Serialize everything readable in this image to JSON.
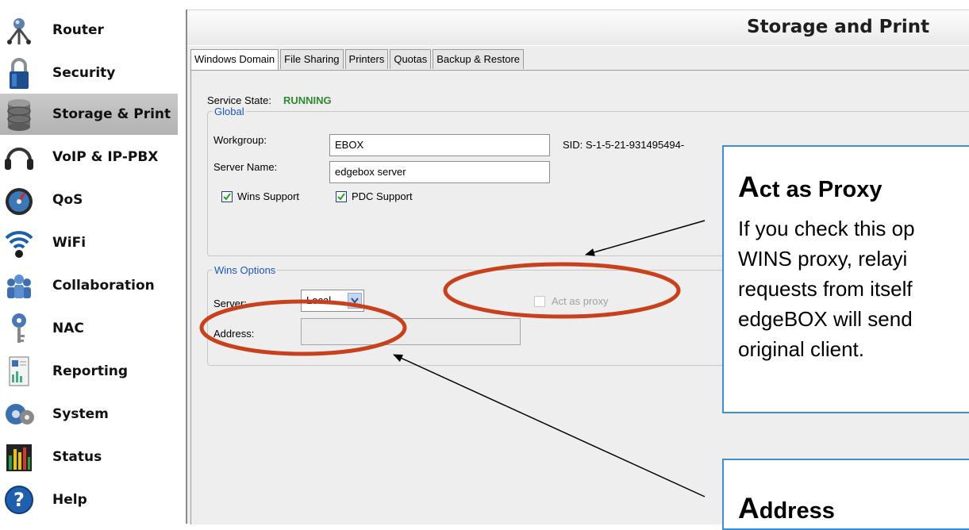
{
  "sidebar": {
    "items": [
      {
        "label": "Router",
        "icon": "router-icon"
      },
      {
        "label": "Security",
        "icon": "padlock-icon"
      },
      {
        "label": "Storage & Print",
        "icon": "database-icon",
        "active": true
      },
      {
        "label": "VoIP & IP-PBX",
        "icon": "headset-icon"
      },
      {
        "label": "QoS",
        "icon": "gauge-icon"
      },
      {
        "label": "WiFi",
        "icon": "wifi-icon"
      },
      {
        "label": "Collaboration",
        "icon": "people-icon"
      },
      {
        "label": "NAC",
        "icon": "keys-icon"
      },
      {
        "label": "Reporting",
        "icon": "report-icon"
      },
      {
        "label": "System",
        "icon": "gears-icon"
      },
      {
        "label": "Status",
        "icon": "bar-chart-icon"
      },
      {
        "label": "Help",
        "icon": "help-icon"
      }
    ]
  },
  "header": {
    "title": "Storage and Print"
  },
  "tabs": [
    {
      "label": "Windows Domain",
      "active": true
    },
    {
      "label": "File Sharing"
    },
    {
      "label": "Printers"
    },
    {
      "label": "Quotas"
    },
    {
      "label": "Backup & Restore"
    }
  ],
  "service": {
    "label": "Service State:",
    "value": "RUNNING",
    "value_color": "#2e8b2e"
  },
  "global": {
    "legend": "Global",
    "workgroup_label": "Workgroup:",
    "workgroup_value": "EBOX",
    "sid": "SID: S-1-5-21-931495494-",
    "server_name_label": "Server Name:",
    "server_name_value": "edgebox server",
    "wins_support_label": "Wins Support",
    "wins_support_checked": true,
    "pdc_support_label": "PDC Support",
    "pdc_support_checked": true
  },
  "wins": {
    "legend": "Wins Options",
    "server_label": "Server:",
    "server_value": "Local",
    "act_as_proxy_label": "Act as proxy",
    "act_as_proxy_checked": false,
    "address_label": "Address:",
    "address_value": ""
  },
  "callouts": {
    "proxy": {
      "title_first": "A",
      "title_rest": "ct as Proxy",
      "lines": [
        "If you check this op",
        "WINS proxy, relayi",
        "requests from itself",
        "edgeBOX will send",
        "original client."
      ]
    },
    "address": {
      "title_first": "A",
      "title_rest": "ddress"
    }
  },
  "colors": {
    "accent": "#3c8fd0",
    "highlight_ellipse": "#c8401c",
    "legend_blue": "#1a56c0"
  }
}
